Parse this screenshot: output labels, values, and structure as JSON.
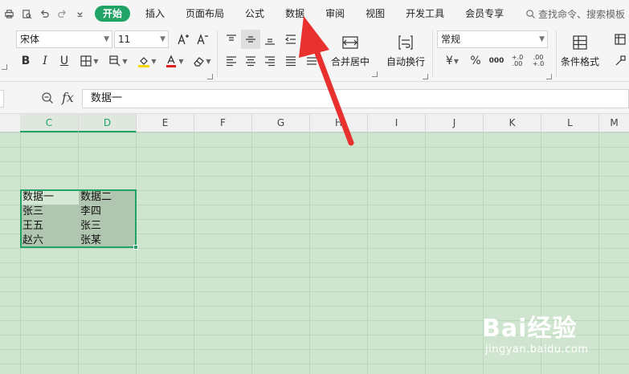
{
  "menubar": {
    "items": [
      "开始",
      "插入",
      "页面布局",
      "公式",
      "数据",
      "审阅",
      "视图",
      "开发工具",
      "会员专享"
    ],
    "active_index": 0,
    "search_placeholder": "查找命令、搜索模板"
  },
  "ribbon": {
    "font_name": "宋体",
    "font_size": "11",
    "number_format": "常规",
    "merge_label": "合并居中",
    "wrap_label": "自动换行",
    "cond_format_label": "条件格式",
    "bold": "B",
    "italic": "I",
    "underline": "U",
    "currency": "¥",
    "percent": "%",
    "thousands": "000",
    "inc_decimal": "+.0\n.00",
    "dec_decimal": ".00\n+.0",
    "font_color_accent": "#e02020",
    "fill_color_accent": "#f5d800"
  },
  "formula_bar": {
    "fx_label": "fx",
    "content": "数据一"
  },
  "columns": [
    "C",
    "D",
    "E",
    "F",
    "G",
    "H",
    "I",
    "J",
    "K",
    "L",
    "M"
  ],
  "selected_columns": [
    "C",
    "D"
  ],
  "cells": {
    "rows": [
      [
        "数据一",
        "数据二"
      ],
      [
        "张三",
        "李四"
      ],
      [
        "王五",
        "张三"
      ],
      [
        "赵六",
        "张某"
      ]
    ]
  },
  "watermark": {
    "brand": "Bai经验",
    "url": "jingyan.baidu.com"
  },
  "colors": {
    "accent": "#21a366",
    "sheet_bg": "#cfe5cf",
    "annotation_arrow": "#e8312f"
  }
}
